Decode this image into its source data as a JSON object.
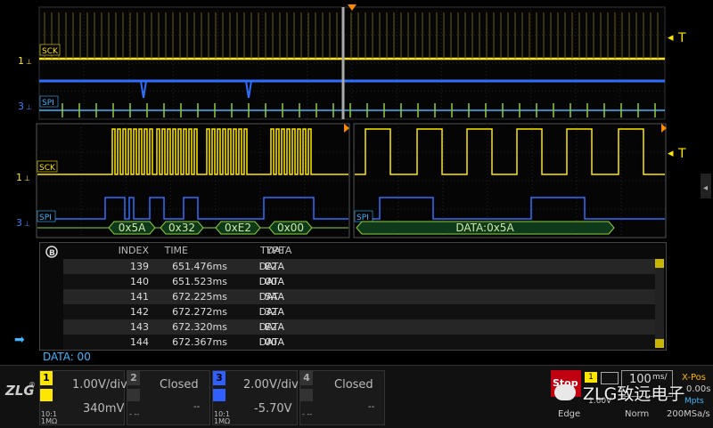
{
  "colors": {
    "ch1": "#ffe600",
    "ch3": "#2f6fff",
    "bus": "#2aa9ff",
    "accent": "#ff8a00",
    "green": "#8fcf3f",
    "cyan": "#3fb6ff"
  },
  "labels": {
    "sck": "SCK",
    "spi": "SPI",
    "ch1_marker": "1",
    "ch3_marker": "3",
    "trigger": "T"
  },
  "decode_bytes": [
    "0x5A",
    "0x32",
    "0xE2",
    "0x00"
  ],
  "decode_zoom": "DATA:0x5A",
  "table": {
    "headers": {
      "index": "INDEX",
      "time": "TIME",
      "type": "TYPE",
      "data": "DATA"
    },
    "rows": [
      {
        "index": "139",
        "time": "651.476ms",
        "type": "DATA",
        "data": "E2"
      },
      {
        "index": "140",
        "time": "651.523ms",
        "type": "DATA",
        "data": "00"
      },
      {
        "index": "141",
        "time": "672.225ms",
        "type": "DATA",
        "data": "5A"
      },
      {
        "index": "142",
        "time": "672.272ms",
        "type": "DATA",
        "data": "32"
      },
      {
        "index": "143",
        "time": "672.320ms",
        "type": "DATA",
        "data": "E2"
      },
      {
        "index": "144",
        "time": "672.367ms",
        "type": "DATA",
        "data": "00"
      }
    ]
  },
  "status_value": "DATA: 00",
  "channels": [
    {
      "num": "1",
      "scale": "1.00V/div",
      "offset": "340mV",
      "probe": "10:1",
      "imp": "1MΩ"
    },
    {
      "num": "2",
      "scale": "Closed",
      "offset": "--",
      "dash": "- --"
    },
    {
      "num": "3",
      "scale": "2.00V/div",
      "offset": "-5.70V",
      "probe": "10:1",
      "imp": "1MΩ"
    },
    {
      "num": "4",
      "scale": "Closed",
      "offset": "--",
      "dash": "- --"
    }
  ],
  "run": {
    "state": "Stop",
    "mode": "Edge",
    "trig_level": "1.60V"
  },
  "timebase": {
    "value": "100",
    "unit": "ms/",
    "norm": "Norm",
    "sample": "200MSa/s",
    "mpts": "Mpts"
  },
  "xpos": {
    "label": "X-Pos",
    "value": "0.00s"
  },
  "brand": {
    "logo": "ZLG",
    "watermark": "ZLG致远电子",
    "reg": "®"
  }
}
